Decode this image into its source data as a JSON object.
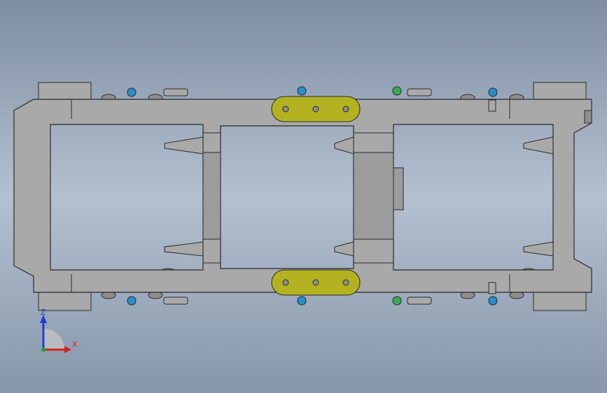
{
  "viewport": {
    "background_top": "#7f8da2",
    "background_mid": "#b3c0d0",
    "background_bottom": "#8796aa"
  },
  "model": {
    "frame_color": "#a9a9a9",
    "frame_dark": "#8e8e8e",
    "frame_outline": "#2a2a2a",
    "opening_color": "#9c9c9c",
    "link_plate_color": "#b3b221",
    "blue_part_color": "#2a8ec8",
    "green_part_color": "#3aaa52"
  },
  "triad": {
    "x_label": "X",
    "z_label": "Z",
    "x_color": "#d42020",
    "z_color": "#1f3fd8",
    "y_color": "#1aa53a"
  }
}
